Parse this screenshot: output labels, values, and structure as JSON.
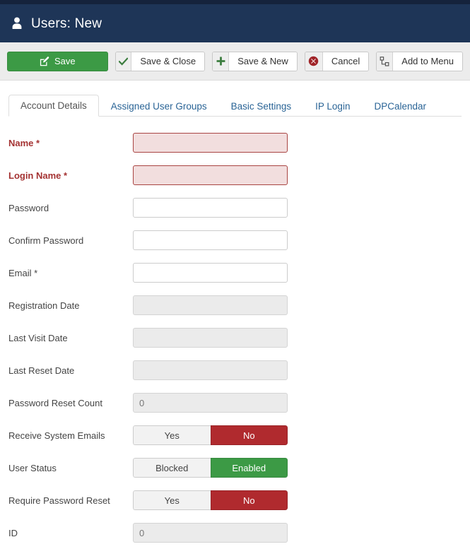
{
  "header": {
    "icon": "user-icon",
    "title": "Users: New"
  },
  "toolbar": {
    "buttons": [
      {
        "label": "Save",
        "icon": "edit-pencil-square-icon",
        "style": "primary"
      },
      {
        "label": "Save & Close",
        "icon": "check-icon",
        "style": "default"
      },
      {
        "label": "Save & New",
        "icon": "plus-icon",
        "style": "default"
      },
      {
        "label": "Cancel",
        "icon": "cancel-circle-x-icon",
        "style": "default"
      },
      {
        "label": "Add to Menu",
        "icon": "sitemap-icon",
        "style": "default"
      }
    ]
  },
  "tabs": [
    {
      "label": "Account Details",
      "active": true
    },
    {
      "label": "Assigned User Groups",
      "active": false
    },
    {
      "label": "Basic Settings",
      "active": false
    },
    {
      "label": "IP Login",
      "active": false
    },
    {
      "label": "DPCalendar",
      "active": false
    }
  ],
  "form": {
    "fields": [
      {
        "label": "Name *",
        "type": "text",
        "value": "",
        "state": "invalid"
      },
      {
        "label": "Login Name *",
        "type": "text",
        "value": "",
        "state": "invalid"
      },
      {
        "label": "Password",
        "type": "text",
        "value": "",
        "state": "normal"
      },
      {
        "label": "Confirm Password",
        "type": "text",
        "value": "",
        "state": "normal"
      },
      {
        "label": "Email *",
        "type": "text",
        "value": "",
        "state": "normal"
      },
      {
        "label": "Registration Date",
        "type": "text",
        "value": "",
        "state": "readonly"
      },
      {
        "label": "Last Visit Date",
        "type": "text",
        "value": "",
        "state": "readonly"
      },
      {
        "label": "Last Reset Date",
        "type": "text",
        "value": "",
        "state": "readonly"
      },
      {
        "label": "Password Reset Count",
        "type": "text",
        "value": "0",
        "state": "readonly"
      },
      {
        "label": "Receive System Emails",
        "type": "toggle",
        "options": [
          "Yes",
          "No"
        ],
        "selected": "No",
        "selected_style": "danger"
      },
      {
        "label": "User Status",
        "type": "toggle",
        "options": [
          "Blocked",
          "Enabled"
        ],
        "selected": "Enabled",
        "selected_style": "success"
      },
      {
        "label": "Require Password Reset",
        "type": "toggle",
        "options": [
          "Yes",
          "No"
        ],
        "selected": "No",
        "selected_style": "danger"
      },
      {
        "label": "ID",
        "type": "text",
        "value": "0",
        "state": "readonly"
      }
    ]
  },
  "colors": {
    "header_bg": "#1e3557",
    "top_strip": "#15233c",
    "toolbar_bg": "#ececec",
    "primary_green": "#3c9a45",
    "danger_red": "#b02a2e",
    "link_blue": "#2a6496",
    "required_label": "#a43232",
    "invalid_field_bg": "#f2dede",
    "invalid_field_border": "#a94442",
    "readonly_field_bg": "#ebebeb"
  }
}
